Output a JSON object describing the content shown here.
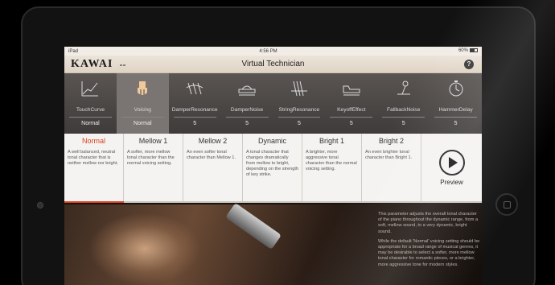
{
  "status": {
    "device": "iPad",
    "time": "4:56 PM",
    "battery": "60%",
    "battery_level": 0.6
  },
  "nav": {
    "logo": "KAWAI",
    "back": "--",
    "title": "Virtual Technician",
    "help": "?"
  },
  "tools": [
    {
      "name": "TouchCurve",
      "value": "Normal",
      "icon": "touch-curve-icon"
    },
    {
      "name": "Voicing",
      "value": "Normal",
      "icon": "voicing-icon"
    },
    {
      "name": "DamperResonance",
      "value": "5",
      "icon": "damper-resonance-icon"
    },
    {
      "name": "DamperNoise",
      "value": "5",
      "icon": "damper-noise-icon"
    },
    {
      "name": "StringResonance",
      "value": "5",
      "icon": "string-resonance-icon"
    },
    {
      "name": "KeyoffEffect",
      "value": "5",
      "icon": "keyoff-effect-icon"
    },
    {
      "name": "FallbackNoise",
      "value": "5",
      "icon": "fallback-noise-icon"
    },
    {
      "name": "HammerDelay",
      "value": "5",
      "icon": "hammer-delay-icon"
    }
  ],
  "voicing_options": [
    {
      "title": "Normal",
      "desc": "A well balanced, neutral tonal character that is neither mellow nor bright."
    },
    {
      "title": "Mellow 1",
      "desc": "A softer, more mellow tonal character than the normal voicing setting."
    },
    {
      "title": "Mellow 2",
      "desc": "An even softer tonal character than Mellow 1."
    },
    {
      "title": "Dynamic",
      "desc": "A tonal character that changes dramatically from mellow to bright, depending on the strength of key strike."
    },
    {
      "title": "Bright 1",
      "desc": "A brighter, more aggressive tonal character than the normal voicing setting."
    },
    {
      "title": "Bright 2",
      "desc": "An even brighter tonal character than Bright 1."
    }
  ],
  "preview": {
    "label": "Preview"
  },
  "info": {
    "p1": "This parameter adjusts the overall tonal character of the piano throughout the dynamic range, from a soft, mellow sound, to a very dynamic, bright sound.",
    "p2": "While the default 'Normal' voicing setting should be appropriate for a broad range of musical genres, it may be desirable to select a softer, more mellow tonal character for romantic pieces, or a brighter, more aggressive tone for modern styles."
  },
  "colors": {
    "accent": "#d9401e",
    "toolbar": "#4a4644"
  }
}
